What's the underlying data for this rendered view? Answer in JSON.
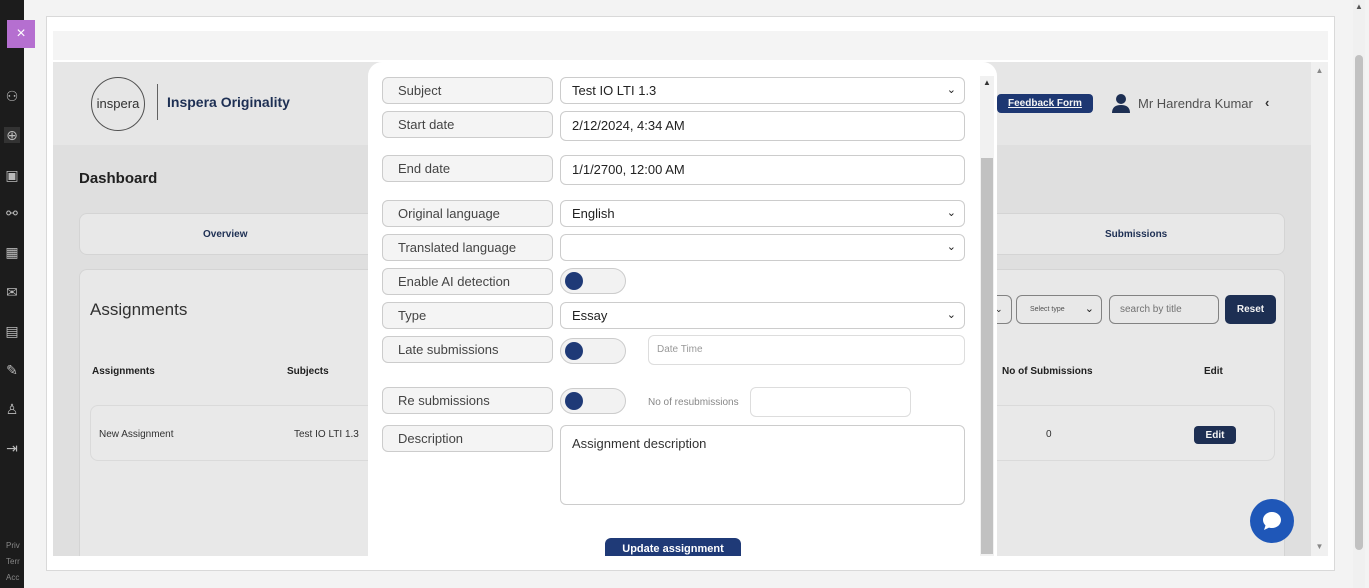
{
  "close_label": "×",
  "footer_links": [
    "Priv",
    "Terr",
    "Acc"
  ],
  "app": {
    "logo_text": "inspera",
    "brand": "Inspera Originality",
    "feedback_label": "Feedback Form",
    "user_name": "Mr Harendra Kumar",
    "user_chevron": "‹",
    "dashboard_title": "Dashboard",
    "tabs": [
      "Overview",
      "Submissions"
    ],
    "assignments_title": "Assignments",
    "filters": {
      "select_type": "Select type",
      "search_placeholder": "search by title",
      "reset_label": "Reset"
    },
    "columns": [
      "Assignments",
      "Subjects",
      "No of Submissions",
      "Edit"
    ],
    "rows": [
      {
        "assignment": "New Assignment",
        "subject": "Test IO LTI 1.3",
        "submissions": "0",
        "edit": "Edit"
      }
    ]
  },
  "modal": {
    "subject": {
      "label": "Subject",
      "value": "Test IO LTI 1.3"
    },
    "start_date": {
      "label": "Start date",
      "value": "2/12/2024, 4:34 AM"
    },
    "end_date": {
      "label": "End date",
      "value": "1/1/2700, 12:00 AM"
    },
    "original_language": {
      "label": "Original language",
      "value": "English"
    },
    "translated_language": {
      "label": "Translated language",
      "value": ""
    },
    "ai_detection": {
      "label": "Enable AI detection"
    },
    "type": {
      "label": "Type",
      "value": "Essay"
    },
    "late_submissions": {
      "label": "Late submissions",
      "datetime_placeholder": "Date Time"
    },
    "re_submissions": {
      "label": "Re submissions",
      "count_label": "No of resubmissions"
    },
    "description": {
      "label": "Description",
      "value": "Assignment description"
    },
    "update_label": "Update assignment"
  },
  "colors": {
    "primary": "#1f3a77",
    "close": "#b56fd0",
    "chat": "#1f57b8"
  }
}
